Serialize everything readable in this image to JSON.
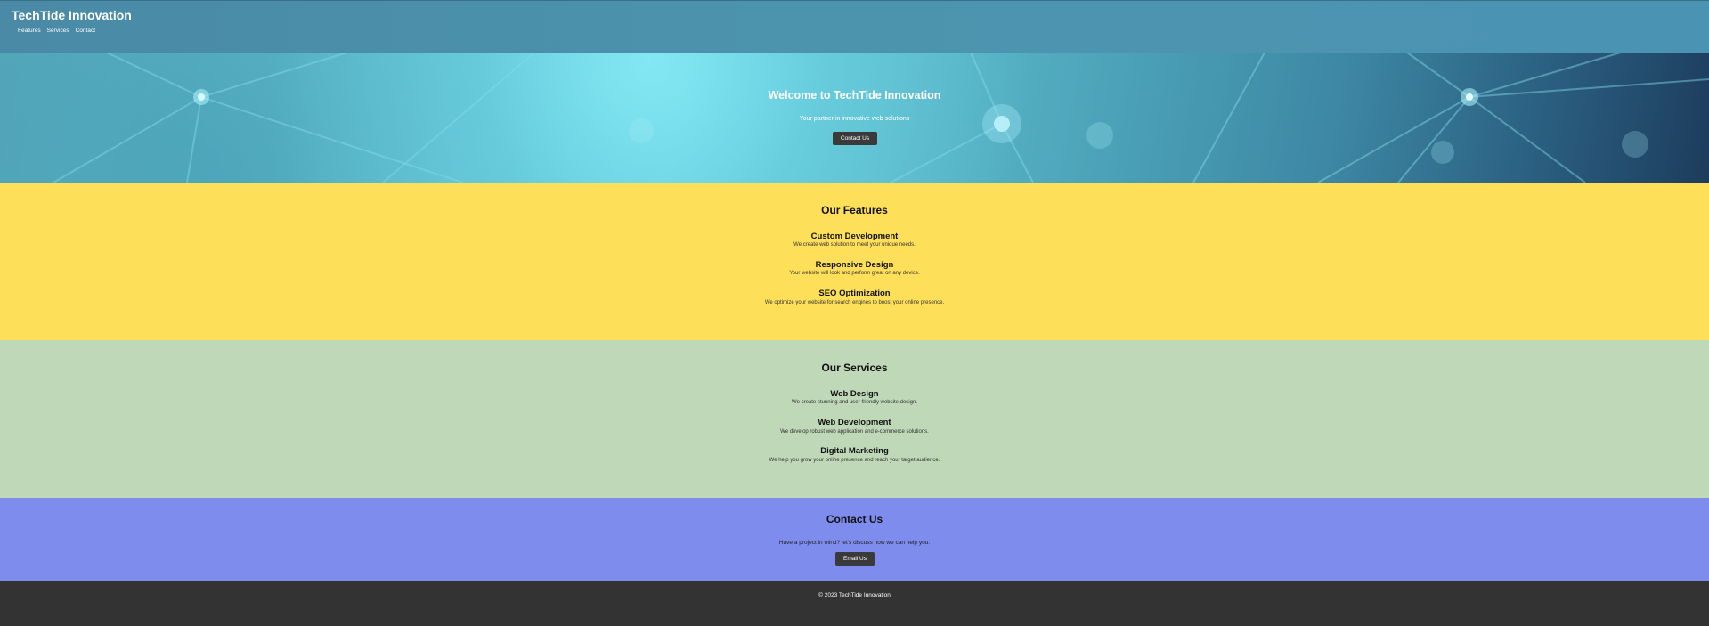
{
  "header": {
    "brand": "TechTide Innovation",
    "nav": [
      "Features",
      "Services",
      "Contact"
    ]
  },
  "hero": {
    "title": "Welcome to TechTide Innovation",
    "subtitle": "Your partner in innovative web solutions",
    "button": "Contact Us"
  },
  "features": {
    "title": "Our Features",
    "items": [
      {
        "title": "Custom Development",
        "desc": "We create web solution to meet your unique needs."
      },
      {
        "title": "Responsive Design",
        "desc": "Your website will look and perform great on any device."
      },
      {
        "title": "SEO Optimization",
        "desc": "We optimize your website for search engines to boost your online presence."
      }
    ]
  },
  "services": {
    "title": "Our Services",
    "items": [
      {
        "title": "Web Design",
        "desc": "We create stunning and user-friendly website design."
      },
      {
        "title": "Web Development",
        "desc": "We develop robust web application and e-commerce solutions."
      },
      {
        "title": "Digital Marketing",
        "desc": "We help you grow your online presence and reach your target audience."
      }
    ]
  },
  "contact": {
    "title": "Contact Us",
    "text": "Have a project in mind? let's discuss how we can help you.",
    "button": "Email Us"
  },
  "footer": {
    "text": "© 2023 TechTide Innovation"
  },
  "colors": {
    "header": "#4b90ad",
    "features_bg": "#fedf5a",
    "services_bg": "#bfd8b8",
    "contact_bg": "#7e8cee",
    "footer_bg": "#333333",
    "button": "#3a3a3a"
  }
}
